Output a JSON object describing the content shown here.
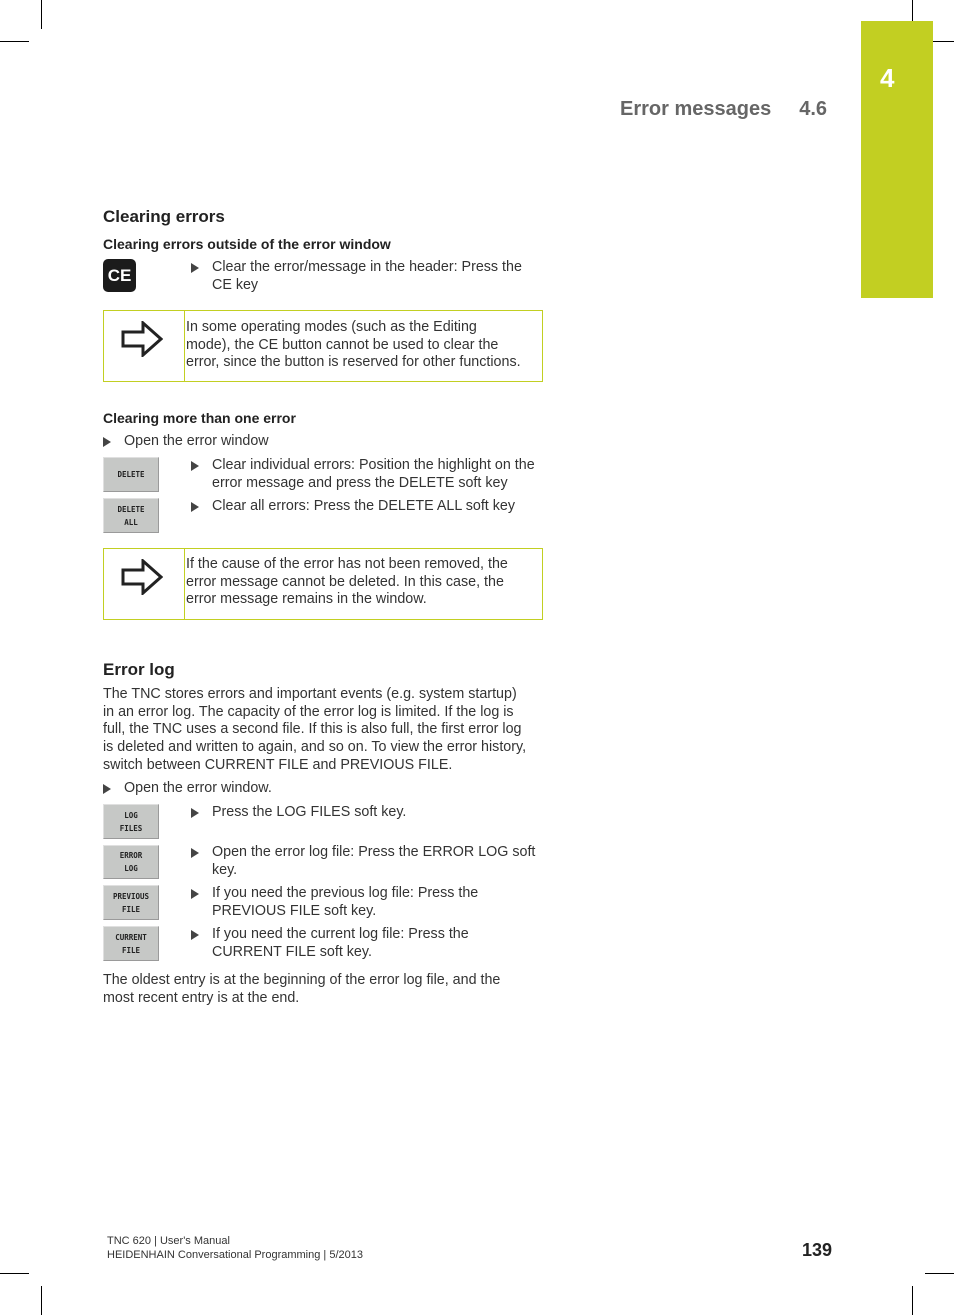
{
  "chapter": {
    "number": "4",
    "color": "#c2cf22"
  },
  "running_head": {
    "title": "Error messages",
    "section": "4.6"
  },
  "clearing_errors": {
    "heading": "Clearing errors",
    "outside": {
      "heading": "Clearing errors outside of the error window",
      "key_label": "CE",
      "step_line1": "Clear the error/message in the header: Press the",
      "step_line2": "CE key",
      "note_lines": [
        "In some operating modes (such as the Editing",
        "mode), the CE button cannot be used to clear the",
        "error, since the button is reserved for other functions."
      ]
    },
    "multiple": {
      "heading": "Clearing more than one error",
      "open_step": "Open the error window",
      "softkeys": [
        {
          "line1": "DELETE",
          "line2": ""
        },
        {
          "line1": "DELETE",
          "line2": "ALL"
        }
      ],
      "steps": [
        {
          "line1": "Clear individual errors: Position the highlight on the",
          "line2": "error message and press the DELETE soft key"
        },
        {
          "line1": "Clear all errors: Press the DELETE ALL soft key",
          "line2": ""
        }
      ],
      "note_lines": [
        "If the cause of the error has not been removed, the",
        "error message cannot be deleted. In this case, the",
        "error message remains in the window."
      ]
    }
  },
  "error_log": {
    "heading": "Error log",
    "intro_lines": [
      "The TNC stores errors and important events (e.g. system startup)",
      "in an error log. The capacity of the error log is limited. If the log is",
      "full, the TNC uses a second file. If this is also full, the first error log",
      "is deleted and written to again, and so on. To view the error history,",
      "switch between CURRENT FILE and PREVIOUS FILE."
    ],
    "open_step": "Open the error window.",
    "softkeys": [
      {
        "line1": "LOG",
        "line2": "FILES"
      },
      {
        "line1": "ERROR",
        "line2": "LOG"
      },
      {
        "line1": "PREVIOUS",
        "line2": "FILE"
      },
      {
        "line1": "CURRENT",
        "line2": "FILE"
      }
    ],
    "steps": [
      {
        "line1": "Press the LOG FILES soft key.",
        "line2": ""
      },
      {
        "line1": "Open the error log file: Press the ERROR LOG soft",
        "line2": "key."
      },
      {
        "line1": "If you need the previous log file: Press the",
        "line2": "PREVIOUS FILE soft key."
      },
      {
        "line1": "If you need the current log file: Press the",
        "line2": "CURRENT FILE soft key."
      }
    ],
    "closing_lines": [
      "The oldest entry is at the beginning of the error log file, and the",
      "most recent entry is at the end."
    ]
  },
  "footer": {
    "line1": "TNC 620 | User's Manual",
    "line2": "HEIDENHAIN Conversational Programming | 5/2013",
    "page_number": "139"
  }
}
